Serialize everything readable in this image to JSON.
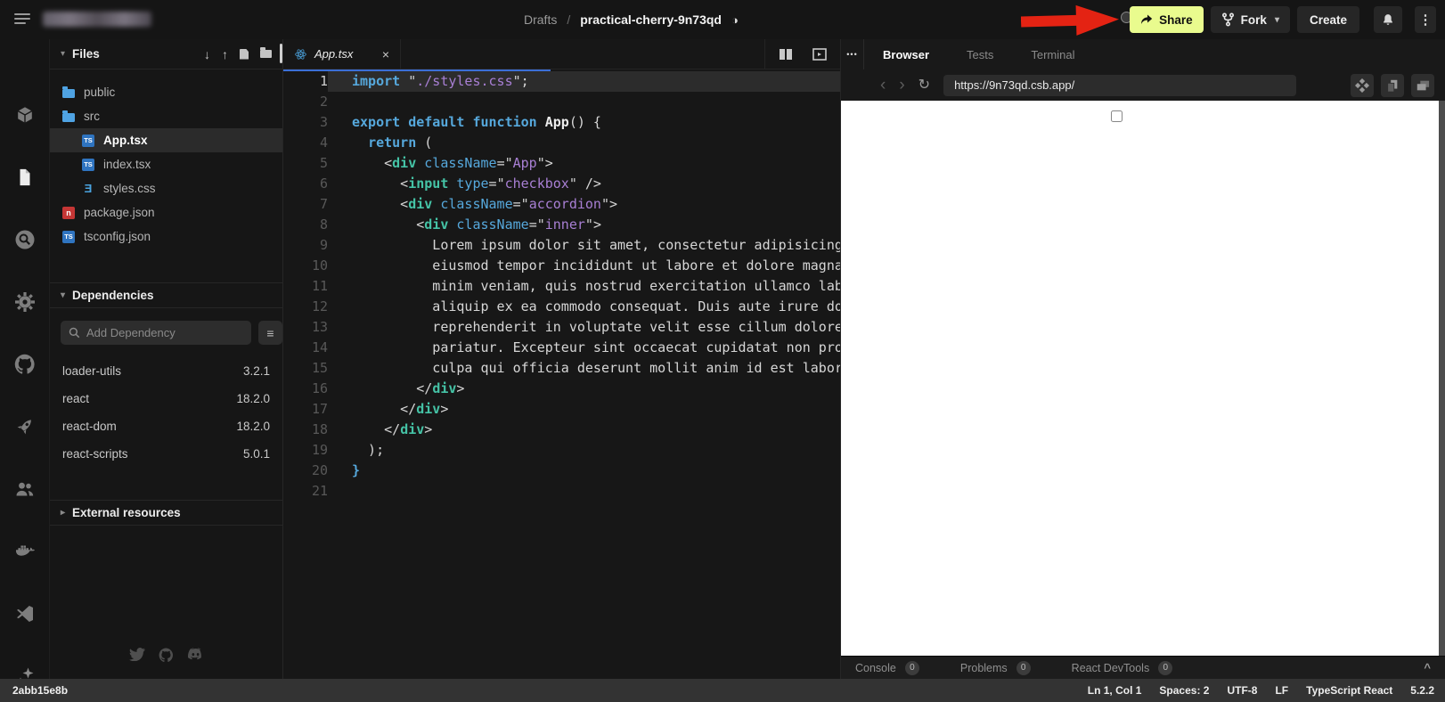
{
  "header": {
    "breadcrumb": {
      "section": "Drafts",
      "separator": "/",
      "name": "practical-cherry-9n73qd"
    },
    "share_label": "Share",
    "fork_label": "Fork",
    "create_label": "Create",
    "share_button_color": "#E9FB8E",
    "annotation_arrow_color": "#E42313"
  },
  "icons": {
    "privacy_globe": "◑",
    "chevron_down": "▾",
    "chevron_right": "▸",
    "more_vertical": "⋮",
    "panel_dots": "•••",
    "back": "‹",
    "forward": "›",
    "refresh": "↻",
    "list": "≡",
    "arrow_down": "↓",
    "arrow_up": "↑",
    "close": "×",
    "expand_up": "^"
  },
  "activity_bar": {
    "active": "files",
    "icons": [
      "package",
      "files",
      "search",
      "settings",
      "github",
      "rocket",
      "team",
      "docker",
      "vscode",
      "ai"
    ]
  },
  "files_panel": {
    "title": "Files",
    "tree": [
      {
        "label": "public",
        "icon": "folder",
        "indent": 1,
        "selected": false
      },
      {
        "label": "src",
        "icon": "folder",
        "indent": 1,
        "selected": false
      },
      {
        "label": "App.tsx",
        "icon": "ts",
        "indent": 2,
        "selected": true
      },
      {
        "label": "index.tsx",
        "icon": "ts",
        "indent": 2,
        "selected": false
      },
      {
        "label": "styles.css",
        "icon": "css",
        "indent": 2,
        "selected": false
      },
      {
        "label": "package.json",
        "icon": "npm",
        "indent": 1,
        "selected": false
      },
      {
        "label": "tsconfig.json",
        "icon": "ts",
        "indent": 1,
        "selected": false
      }
    ],
    "dependencies": {
      "title": "Dependencies",
      "search_placeholder": "Add Dependency",
      "items": [
        {
          "name": "loader-utils",
          "version": "3.2.1"
        },
        {
          "name": "react",
          "version": "18.2.0"
        },
        {
          "name": "react-dom",
          "version": "18.2.0"
        },
        {
          "name": "react-scripts",
          "version": "5.0.1"
        }
      ]
    },
    "external_resources_title": "External resources"
  },
  "editor": {
    "tab_label": "App.tsx",
    "lines": [
      [
        [
          "k",
          "import"
        ],
        [
          "x",
          " "
        ],
        [
          "q",
          "\""
        ],
        [
          "s",
          "./styles.css"
        ],
        [
          "q",
          "\""
        ],
        [
          "x",
          ";"
        ]
      ],
      [],
      [
        [
          "k",
          "export"
        ],
        [
          "x",
          " "
        ],
        [
          "k",
          "default"
        ],
        [
          "x",
          " "
        ],
        [
          "k",
          "function"
        ],
        [
          "x",
          " "
        ],
        [
          "n",
          "App"
        ],
        [
          "x",
          "() {"
        ]
      ],
      [
        [
          "x",
          "  "
        ],
        [
          "k",
          "return"
        ],
        [
          "x",
          " ("
        ]
      ],
      [
        [
          "x",
          "    <"
        ],
        [
          "t",
          "div"
        ],
        [
          "x",
          " "
        ],
        [
          "a",
          "className"
        ],
        [
          "x",
          "="
        ],
        [
          "q",
          "\""
        ],
        [
          "s",
          "App"
        ],
        [
          "q",
          "\""
        ],
        [
          "x",
          ">"
        ]
      ],
      [
        [
          "x",
          "      <"
        ],
        [
          "t",
          "input"
        ],
        [
          "x",
          " "
        ],
        [
          "a",
          "type"
        ],
        [
          "x",
          "="
        ],
        [
          "q",
          "\""
        ],
        [
          "s",
          "checkbox"
        ],
        [
          "q",
          "\""
        ],
        [
          "x",
          " />"
        ]
      ],
      [
        [
          "x",
          "      <"
        ],
        [
          "t",
          "div"
        ],
        [
          "x",
          " "
        ],
        [
          "a",
          "className"
        ],
        [
          "x",
          "="
        ],
        [
          "q",
          "\""
        ],
        [
          "s",
          "accordion"
        ],
        [
          "q",
          "\""
        ],
        [
          "x",
          ">"
        ]
      ],
      [
        [
          "x",
          "        <"
        ],
        [
          "t",
          "div"
        ],
        [
          "x",
          " "
        ],
        [
          "a",
          "className"
        ],
        [
          "x",
          "="
        ],
        [
          "q",
          "\""
        ],
        [
          "s",
          "inner"
        ],
        [
          "q",
          "\""
        ],
        [
          "x",
          ">"
        ]
      ],
      [
        [
          "x",
          "          Lorem ipsum dolor sit amet, consectetur adipisicing elit, sed do"
        ]
      ],
      [
        [
          "x",
          "          eiusmod tempor incididunt ut labore et dolore magna aliqua. Ut enim ad"
        ]
      ],
      [
        [
          "x",
          "          minim veniam, quis nostrud exercitation ullamco laboris nisi ut"
        ]
      ],
      [
        [
          "x",
          "          aliquip ex ea commodo consequat. Duis aute irure dolor in"
        ]
      ],
      [
        [
          "x",
          "          reprehenderit in voluptate velit esse cillum dolore eu fugiat nulla"
        ]
      ],
      [
        [
          "x",
          "          pariatur. Excepteur sint occaecat cupidatat non proident, sunt in"
        ]
      ],
      [
        [
          "x",
          "          culpa qui officia deserunt mollit anim id est laborum."
        ]
      ],
      [
        [
          "x",
          "        </"
        ],
        [
          "t",
          "div"
        ],
        [
          "x",
          ">"
        ]
      ],
      [
        [
          "x",
          "      </"
        ],
        [
          "t",
          "div"
        ],
        [
          "x",
          ">"
        ]
      ],
      [
        [
          "x",
          "    </"
        ],
        [
          "t",
          "div"
        ],
        [
          "x",
          ">"
        ]
      ],
      [
        [
          "x",
          "  );"
        ]
      ],
      [
        [
          "b",
          "}"
        ]
      ],
      []
    ]
  },
  "browser": {
    "tabs": [
      {
        "label": "Browser",
        "active": true
      },
      {
        "label": "Tests",
        "active": false
      },
      {
        "label": "Terminal",
        "active": false
      }
    ],
    "url": "https://9n73qd.csb.app/",
    "checkbox_checked": false,
    "console_bar": {
      "items": [
        {
          "label": "Console",
          "count": "0"
        },
        {
          "label": "Problems",
          "count": "0"
        },
        {
          "label": "React DevTools",
          "count": "0"
        }
      ]
    }
  },
  "status_bar": {
    "left": "2abb15e8b",
    "right": [
      "Ln 1, Col 1",
      "Spaces: 2",
      "UTF-8",
      "LF",
      "TypeScript React",
      "5.2.2"
    ]
  }
}
